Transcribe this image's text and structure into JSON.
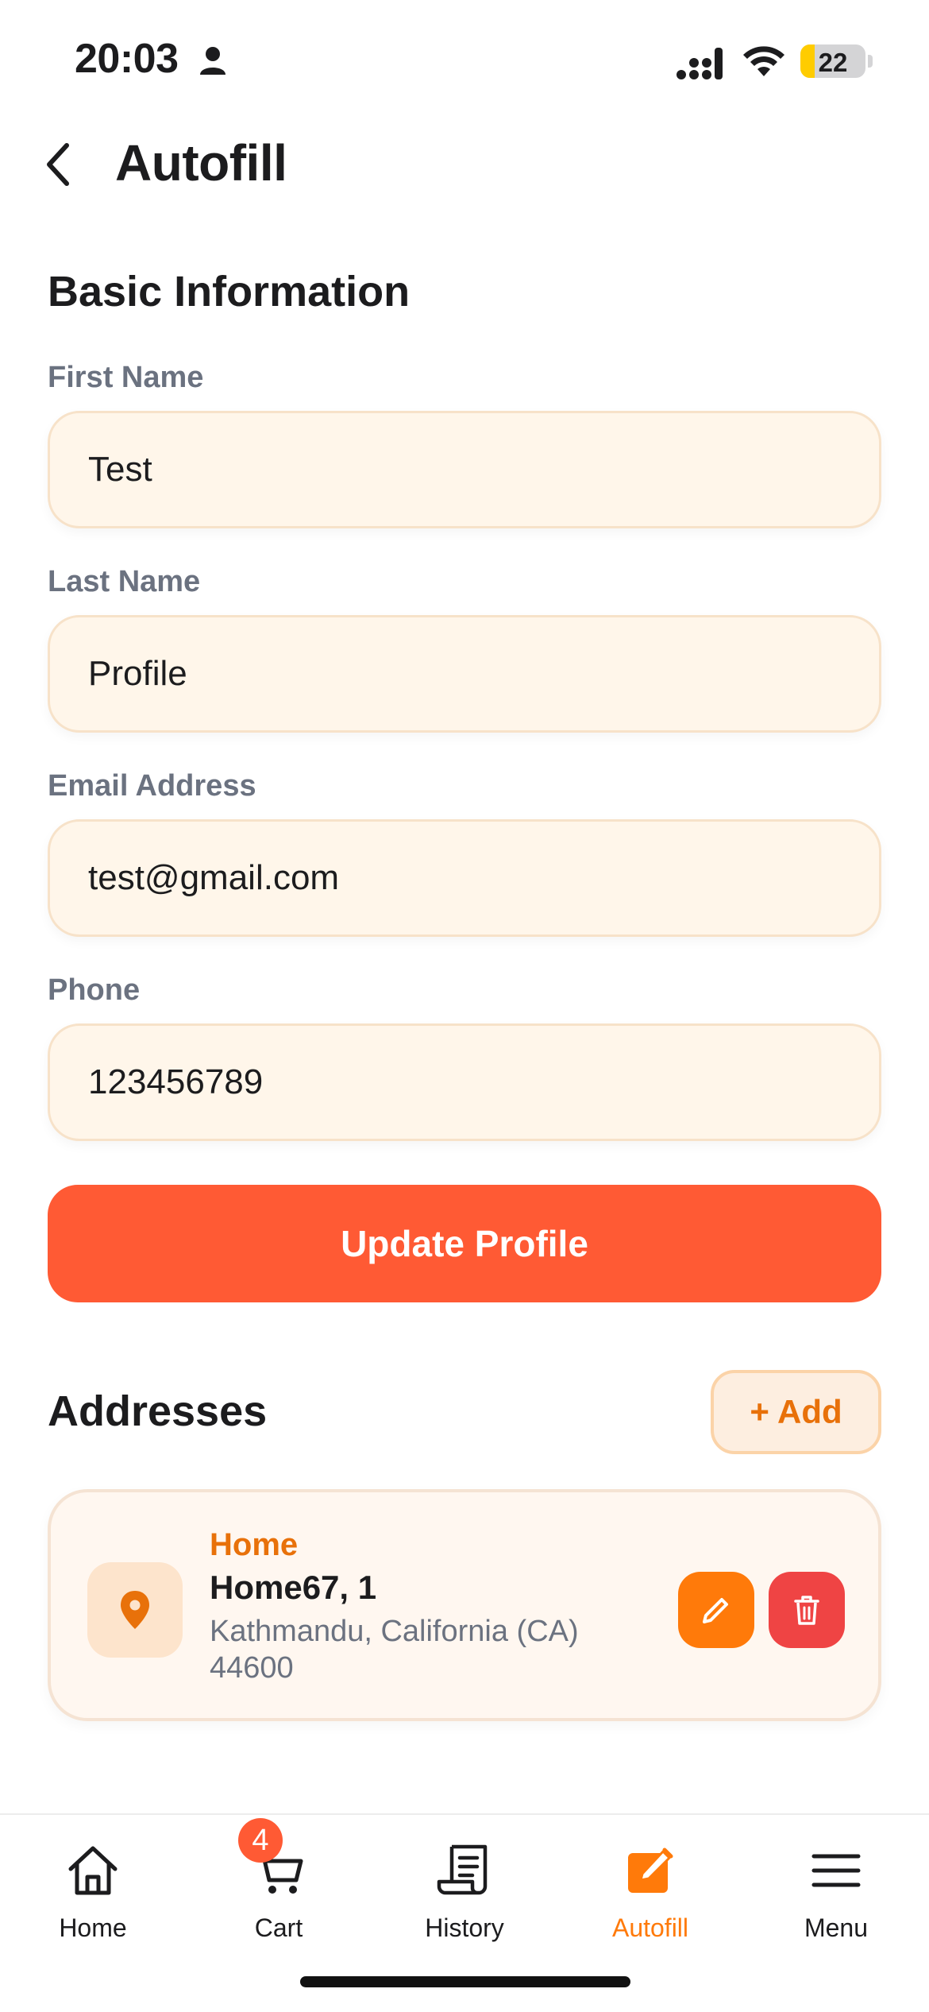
{
  "status_bar": {
    "time": "20:03",
    "battery_level": "22",
    "battery_fraction": 0.22
  },
  "header": {
    "title": "Autofill"
  },
  "basic_info": {
    "section_title": "Basic Information",
    "fields": [
      {
        "label": "First Name",
        "value": "Test"
      },
      {
        "label": "Last Name",
        "value": "Profile"
      },
      {
        "label": "Email Address",
        "value": "test@gmail.com"
      },
      {
        "label": "Phone",
        "value": "123456789"
      }
    ],
    "update_label": "Update Profile"
  },
  "addresses": {
    "section_title": "Addresses",
    "add_label": "+ Add",
    "items": [
      {
        "label": "Home",
        "name": "Home67, 1",
        "line1": "Kathmandu, California (CA)",
        "line2": "44600"
      }
    ]
  },
  "tab_bar": {
    "items": [
      {
        "label": "Home",
        "icon": "home-icon"
      },
      {
        "label": "Cart",
        "icon": "cart-icon"
      },
      {
        "label": "History",
        "icon": "history-icon"
      },
      {
        "label": "Autofill",
        "icon": "autofill-icon"
      },
      {
        "label": "Menu",
        "icon": "menu-icon"
      }
    ],
    "cart_badge": "4",
    "active_index": 3
  },
  "colors": {
    "accent": "#ff5a34",
    "orange": "#ff7a0a",
    "danger": "#ef4444",
    "input_bg": "#fff6ea"
  }
}
